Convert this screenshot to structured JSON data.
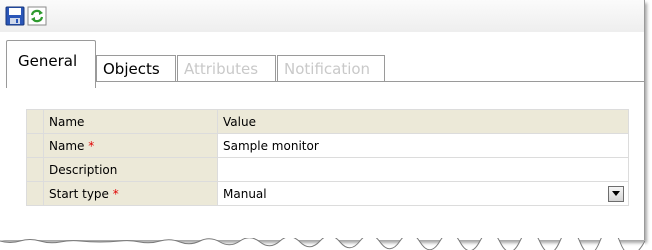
{
  "toolbar": {
    "save_icon": "save-icon",
    "refresh_icon": "refresh-icon"
  },
  "tabs": [
    {
      "label": "General",
      "state": "active"
    },
    {
      "label": "Objects",
      "state": "enabled"
    },
    {
      "label": "Attributes",
      "state": "disabled"
    },
    {
      "label": "Notification",
      "state": "disabled"
    }
  ],
  "grid": {
    "header": {
      "name": "Name",
      "value": "Value"
    },
    "rows": [
      {
        "name": "Name",
        "required": "*",
        "value": "Sample monitor"
      },
      {
        "name": "Description",
        "required": "",
        "value": ""
      },
      {
        "name": "Start type",
        "required": "*",
        "value": "Manual"
      }
    ]
  },
  "colors": {
    "grid_header_bg": "#ece9d8",
    "required_marker": "#e00000",
    "disabled_tab_text": "#c9c9c9"
  }
}
